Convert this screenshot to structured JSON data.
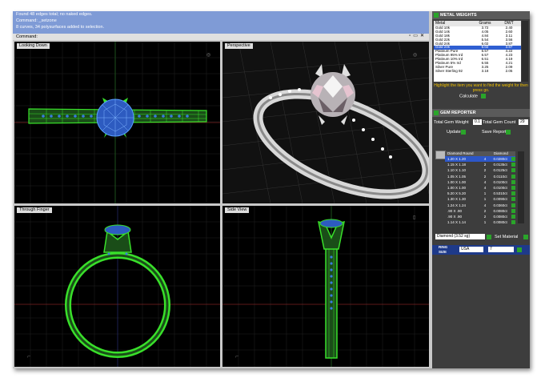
{
  "command_log": {
    "lines": [
      "Found 48 edges total; no naked edges.",
      "Command: _setzone",
      "8 curves, 34 polysurfaces added to selection."
    ],
    "prompt": "Command:"
  },
  "viewports": {
    "top": "Looking Down",
    "perspective": "Perspective",
    "front": "Through Finger",
    "right": "Side View"
  },
  "metal_weights": {
    "title": "METAL WEIGHTS",
    "columns": [
      "Metal",
      "Grams",
      "DWT"
    ],
    "rows": [
      [
        "Gold 10k",
        "3.72",
        "2.40"
      ],
      [
        "Gold 14k",
        "4.05",
        "2.60"
      ],
      [
        "Gold 18k",
        "4.84",
        "3.11"
      ],
      [
        "Gold 22k",
        "5.54",
        "3.56"
      ],
      [
        "Gold 24k",
        "6.02",
        "3.87"
      ],
      [
        "Gold 24k",
        "6.02",
        "3.87"
      ],
      [
        "Platinum Pure",
        "6.57",
        "4.22"
      ],
      [
        "Platinum 95% Ird",
        "6.57",
        "4.23"
      ],
      [
        "Platinum 10% Ird",
        "6.51",
        "4.19"
      ],
      [
        "Platinum 5% Ird",
        "6.55",
        "4.21"
      ],
      [
        "Silver Pure",
        "3.25",
        "2.09"
      ],
      [
        "Silver Sterling 92",
        "3.18",
        "2.05"
      ]
    ],
    "selected_index": 5,
    "hint": "Highlight the item you want to find the weight for then press go.",
    "calculate_label": "Calculate"
  },
  "gem_reporter": {
    "title": "GEM REPORTER",
    "total_weight_label": "Total Gem Weight",
    "total_weight_value": "0.1",
    "total_count_label": "Total Gem Count",
    "total_count_value": "29",
    "update_label": "Update",
    "save_report_label": "Save Report",
    "columns": [
      "Diamond Round",
      "",
      "Diamond"
    ],
    "rows": [
      [
        "1.20 X 1.20",
        "4",
        "0.0280ct"
      ],
      [
        "1.15 X 1.18",
        "2",
        "0.0135ct"
      ],
      [
        "1.10 X 1.10",
        "2",
        "0.0125ct"
      ],
      [
        "1.05 X 1.05",
        "2",
        "0.0110ct"
      ],
      [
        "1.00 X 1.00",
        "4",
        "0.0100ct"
      ],
      [
        "1.00 X 1.00",
        "4",
        "0.0100ct"
      ],
      [
        "5.20 X 5.20",
        "1",
        "0.5310ct"
      ],
      [
        "1.30 X 1.30",
        "1",
        "0.0090ct"
      ],
      [
        "1.24 X 1.24",
        "4",
        "0.0360ct"
      ],
      [
        ".90 X .90",
        "2",
        "0.0080ct"
      ],
      [
        ".90 X .90",
        "2",
        "0.0080ct"
      ],
      [
        "1.14 X 1.14",
        "1",
        "0.0080ct"
      ]
    ],
    "selected_index": 0,
    "material_value": "Diamond (3.52 sg)",
    "set_material_label": "Set Material"
  },
  "ring_size": {
    "label": "RING SIZE",
    "region": "USA",
    "size": "7"
  },
  "colors": {
    "wire_green": "#39e02a",
    "wire_blue": "#3a7de0",
    "viewport_bg": "#000000",
    "panel_bg": "#3d3d3d",
    "command_bg": "#1f43c2",
    "hint_yellow": "#f2c200"
  }
}
